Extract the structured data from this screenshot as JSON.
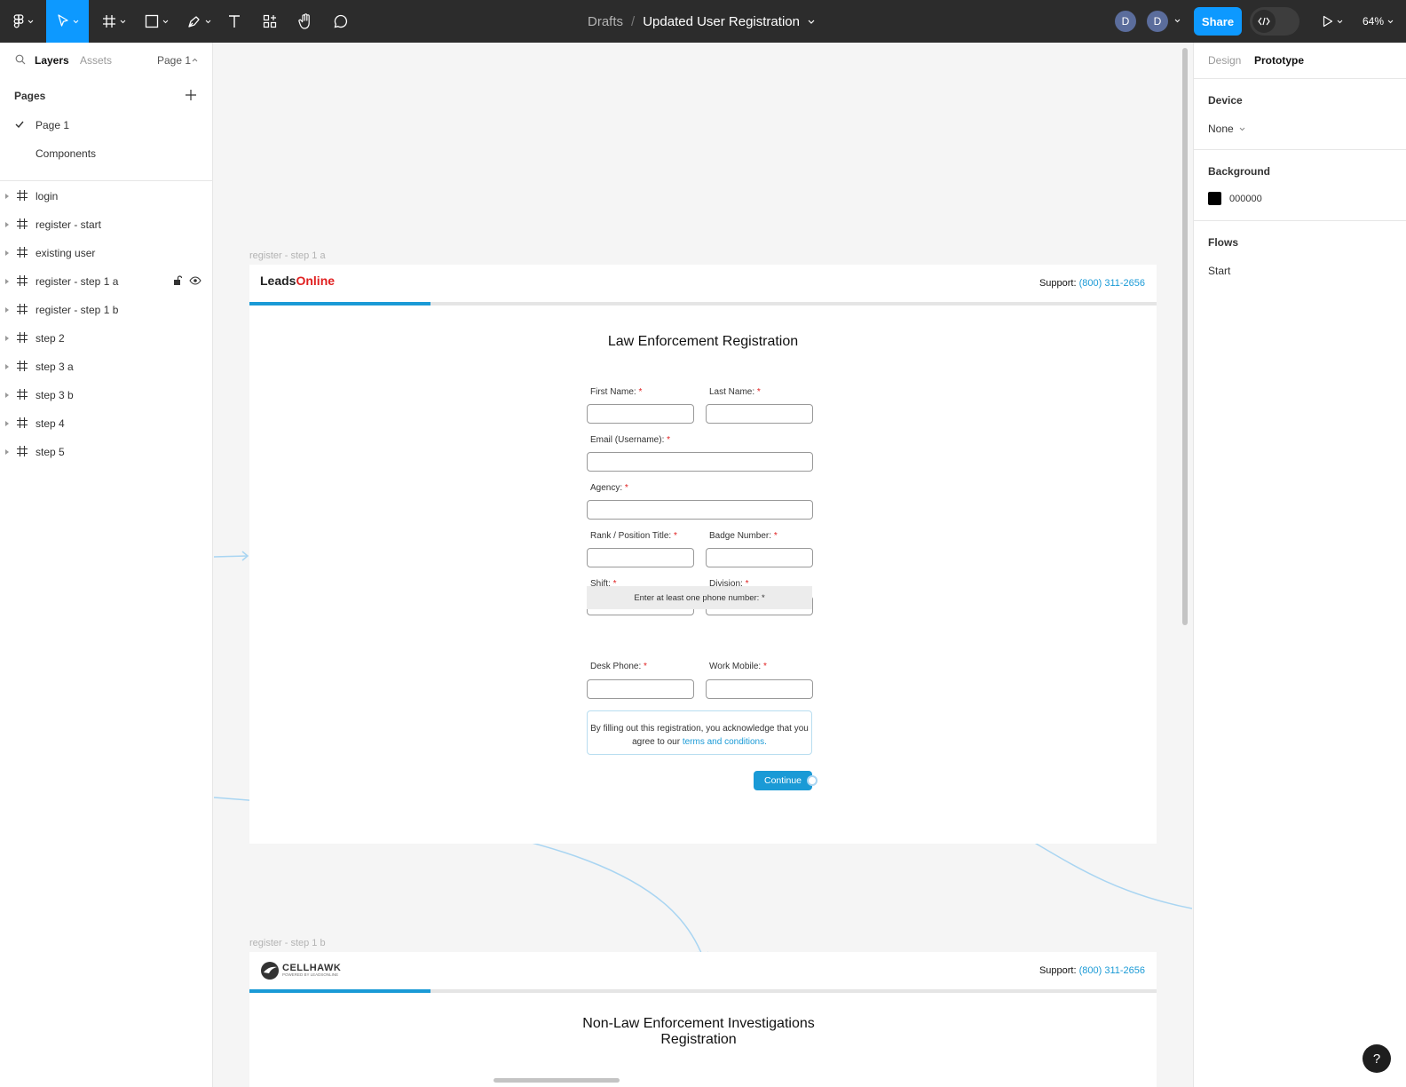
{
  "toolbar": {
    "breadcrumb_root": "Drafts",
    "breadcrumb_sep": "/",
    "file_name": "Updated User Registration",
    "avatar1": "D",
    "avatar2": "D",
    "share_label": "Share",
    "zoom": "64%"
  },
  "left_panel": {
    "tab_layers": "Layers",
    "tab_assets": "Assets",
    "page_selector": "Page 1",
    "pages_heading": "Pages",
    "pages": [
      "Page 1",
      "Components"
    ],
    "layers": [
      "login",
      "register - start",
      "existing user",
      "register - step 1 a",
      "register - step 1 b",
      "step 2",
      "step 3 a",
      "step 3 b",
      "step 4",
      "step 5"
    ]
  },
  "right_panel": {
    "tab_design": "Design",
    "tab_prototype": "Prototype",
    "device_title": "Device",
    "device_value": "None",
    "background_title": "Background",
    "background_value": "000000",
    "background_color": "#000000",
    "flows_title": "Flows",
    "flows_value": "Start"
  },
  "frame_a": {
    "label": "register - step 1 a",
    "logo_leads": "Leads",
    "logo_online": "Online",
    "support_label": "Support:",
    "support_phone": "(800) 311-2656",
    "progress": 0.2,
    "title": "Law Enforcement Registration",
    "first_name": "First Name:",
    "last_name": "Last Name:",
    "email": "Email (Username):",
    "agency": "Agency:",
    "rank": "Rank / Position Title:",
    "badge": "Badge Number:",
    "shift": "Shift:",
    "division": "Division:",
    "phone_note": "Enter at least one phone number: *",
    "desk_phone": "Desk Phone:",
    "work_mobile": "Work Mobile:",
    "required_mark": "*",
    "terms_text": "By filling out this registration, you acknowledge that you agree to our",
    "terms_link": "terms and conditions.",
    "continue_label": "Continue"
  },
  "frame_b": {
    "label": "register - step 1 b",
    "logo_text": "CELLHAWK",
    "logo_sub": "POWERED BY LEADSONLINE",
    "support_label": "Support:",
    "support_phone": "(800) 311-2656",
    "progress": 0.2,
    "title_line1": "Non-Law Enforcement Investigations",
    "title_line2": "Registration"
  },
  "help_label": "?"
}
